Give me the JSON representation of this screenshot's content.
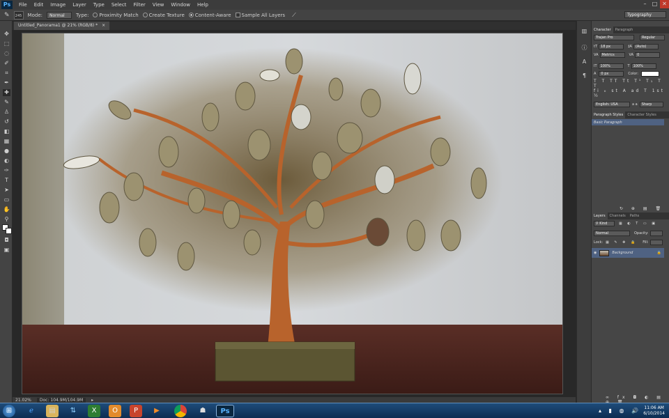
{
  "app": {
    "logo": "Ps"
  },
  "menu": [
    "File",
    "Edit",
    "Image",
    "Layer",
    "Type",
    "Select",
    "Filter",
    "View",
    "Window",
    "Help"
  ],
  "window_controls": [
    "–",
    "□",
    "✕"
  ],
  "options": {
    "brush_size": "245",
    "mode_label": "Mode:",
    "mode_value": "Normal",
    "type_label": "Type:",
    "proximity": "Proximity Match",
    "texture": "Create Texture",
    "content_aware": "Content-Aware",
    "sample_all": "Sample All Layers",
    "workspace": "Typography"
  },
  "document": {
    "tab": "Untitled_Panorama1 @ 21% (RGB/8) *"
  },
  "status": {
    "zoom": "21.02%",
    "doc": "Doc: 104.9M/104.9M"
  },
  "character": {
    "tab1": "Character",
    "tab2": "Paragraph",
    "font": "Trajan Pro",
    "style": "Regular",
    "size": "18 px",
    "leading": "(Auto)",
    "kerning": "Metrics",
    "tracking": "0",
    "vscale": "100%",
    "hscale": "100%",
    "baseline": "0 px",
    "color_label": "Color:",
    "lang": "English: USA",
    "aa_label": "a a",
    "aa": "Sharp"
  },
  "styles": {
    "tab1": "Paragraph Styles",
    "tab2": "Character Styles",
    "item": "Basic Paragraph"
  },
  "layers": {
    "tab1": "Layers",
    "tab2": "Channels",
    "tab3": "Paths",
    "kind": "Kind",
    "blend": "Normal",
    "opacity_label": "Opacity:",
    "lock_label": "Lock:",
    "fill_label": "Fill:",
    "layer_name": "Background"
  },
  "taskbar": {
    "time": "11:06 AM",
    "date": "6/10/2014"
  },
  "colors": {
    "accent": "#2d5a8c",
    "bg": "#282828",
    "panel": "#464646"
  }
}
